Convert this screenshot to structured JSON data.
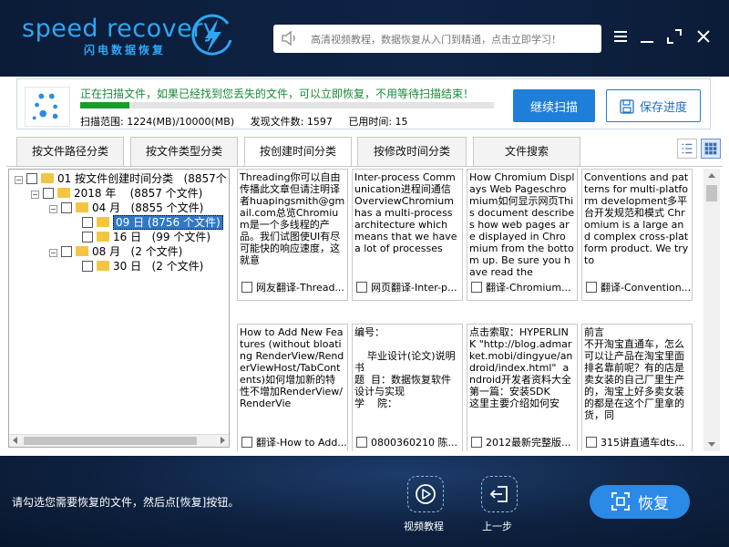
{
  "header": {
    "logo_main": "speed recovery",
    "logo_sub": "闪电数据恢复",
    "search_placeholder": "高清视频教程，数据恢复从入门到精通，点击立即学习！"
  },
  "scan": {
    "message": "正在扫描文件，如果已经找到您丢失的文件，可以立即恢复，不用等待扫描结束！",
    "progress": 0.12,
    "range_label": "扫描范围: 1224(MB)/10000(MB)",
    "found_label": "发现文件数: 1597",
    "time_label": "已用时间: 15",
    "continue_label": "继续扫描",
    "save_label": "保存进度"
  },
  "tabs": [
    {
      "label": "按文件路径分类"
    },
    {
      "label": "按文件类型分类"
    },
    {
      "label": "按创建时间分类"
    },
    {
      "label": "按修改时间分类"
    },
    {
      "label": "文件搜索"
    }
  ],
  "tree": [
    {
      "label": "01 按文件创建时间分类",
      "count": "(8857个"
    },
    {
      "label": "2018 年",
      "count": "(8857 个文件)"
    },
    {
      "label": "04 月",
      "count": "(8855 个文件)"
    },
    {
      "label": "09 日",
      "count": "(8756 个文件)"
    },
    {
      "label": "16 日",
      "count": "(99 个文件)"
    },
    {
      "label": "08 月",
      "count": "(2 个文件)"
    },
    {
      "label": "30 日",
      "count": "(2 个文件)"
    }
  ],
  "cards": [
    {
      "preview": "Threading你可以自由传播此文章但请注明译者huapingsmith@gmail.com总览Chromium是一个多线程的产品。我们试图使UI有尽可能快的响应速度，这就意",
      "name": "网友翻译-Thread..."
    },
    {
      "preview": "Inter-process Communication进程间通信 OverviewChromium has a multi-process architecture which means that we have a lot of processes",
      "name": "网页翻译-Inter-p..."
    },
    {
      "preview": "How Chromium Displays Web Pageschromium如何显示网页This document describes how web pages are displayed in Chromium from the bottom up. Be sure you have read the",
      "name": "翻译-Chromium..."
    },
    {
      "preview": "Conventions and patterns for multi-platform development多平台开发规范和模式 Chromium is a large and complex cross-platform product. We try to",
      "name": "翻译-Convention..."
    },
    {
      "preview": "How to Add New Features (without bloating RenderView/RenderViewHost/TabContents)如何增加新的特性不增加RenderView/RenderVie",
      "name": "翻译-How to Add..."
    },
    {
      "preview": "编号：\n\n    毕业设计(论文)说明书\n题  目：数据恢复软件设计与实现\n学    院：",
      "name": "0800360210 陈..."
    },
    {
      "preview": "点击索取：HYPERLINK \"http://blog.admarket.mobi/dingyue/android/index.html\"  android开发者资料大全\n第一篇：安装SDK\n这里主要介绍如何安",
      "name": "2012最新完整版..."
    },
    {
      "preview": "前言\n不开淘宝直通车，怎么可以让产品在淘宝里面排名靠前呢？有的店是卖女装的自己厂里生产的，淘宝上好多卖女装的都是在这个厂里拿的货，同",
      "name": "315讲直通车dts..."
    }
  ],
  "footer": {
    "hint": "请勾选您需要恢复的文件，然后点[恢复]按钮。",
    "video_label": "视频教程",
    "back_label": "上一步",
    "recover_label": "恢复"
  },
  "colors": {
    "accent": "#2a8ae6",
    "header_bg": "#0b1c38",
    "progress": "#1a9b2a",
    "scan_text": "#1a8a38"
  }
}
